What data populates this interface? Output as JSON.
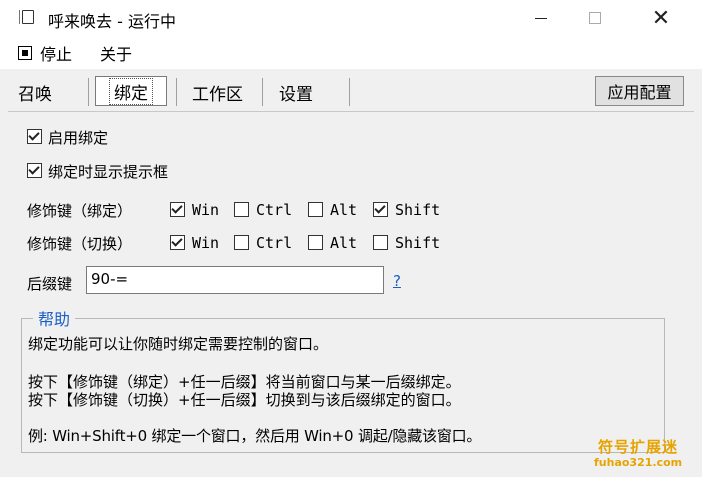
{
  "window": {
    "title": "呼来唤去 - 运行中",
    "close_glyph": "✕"
  },
  "menu": {
    "stop": "停止",
    "about": "关于"
  },
  "tabs": {
    "summon": "召唤",
    "bind": "绑定",
    "workspace": "工作区",
    "settings": "设置",
    "active": "绑定"
  },
  "apply_button": "应用配置",
  "options": {
    "enable_bind": {
      "label": "启用绑定",
      "checked": true
    },
    "show_prompt": {
      "label": "绑定时显示提示框",
      "checked": true
    }
  },
  "modifiers": {
    "bind": {
      "label": "修饰键（绑定）",
      "win": {
        "label": "Win",
        "checked": true
      },
      "ctrl": {
        "label": "Ctrl",
        "checked": false
      },
      "alt": {
        "label": "Alt",
        "checked": false
      },
      "shift": {
        "label": "Shift",
        "checked": true
      }
    },
    "switch": {
      "label": "修饰键（切换）",
      "win": {
        "label": "Win",
        "checked": true
      },
      "ctrl": {
        "label": "Ctrl",
        "checked": false
      },
      "alt": {
        "label": "Alt",
        "checked": false
      },
      "shift": {
        "label": "Shift",
        "checked": false
      }
    }
  },
  "suffix": {
    "label": "后缀键",
    "value": "90-=",
    "help_link": "?"
  },
  "help": {
    "title": "帮助",
    "line1": "绑定功能可以让你随时绑定需要控制的窗口。",
    "line2": "按下【修饰键（绑定）+任一后缀】将当前窗口与某一后缀绑定。",
    "line3": "按下【修饰键（切换）+任一后缀】切换到与该后缀绑定的窗口。",
    "line4": "例: Win+Shift+0 绑定一个窗口，然后用 Win+0 调起/隐藏该窗口。"
  },
  "watermark": {
    "line1": "符号扩展迷",
    "line2": "fuhao321.com"
  },
  "colors": {
    "link": "#1a5fc8",
    "watermark": "#e6a400"
  }
}
